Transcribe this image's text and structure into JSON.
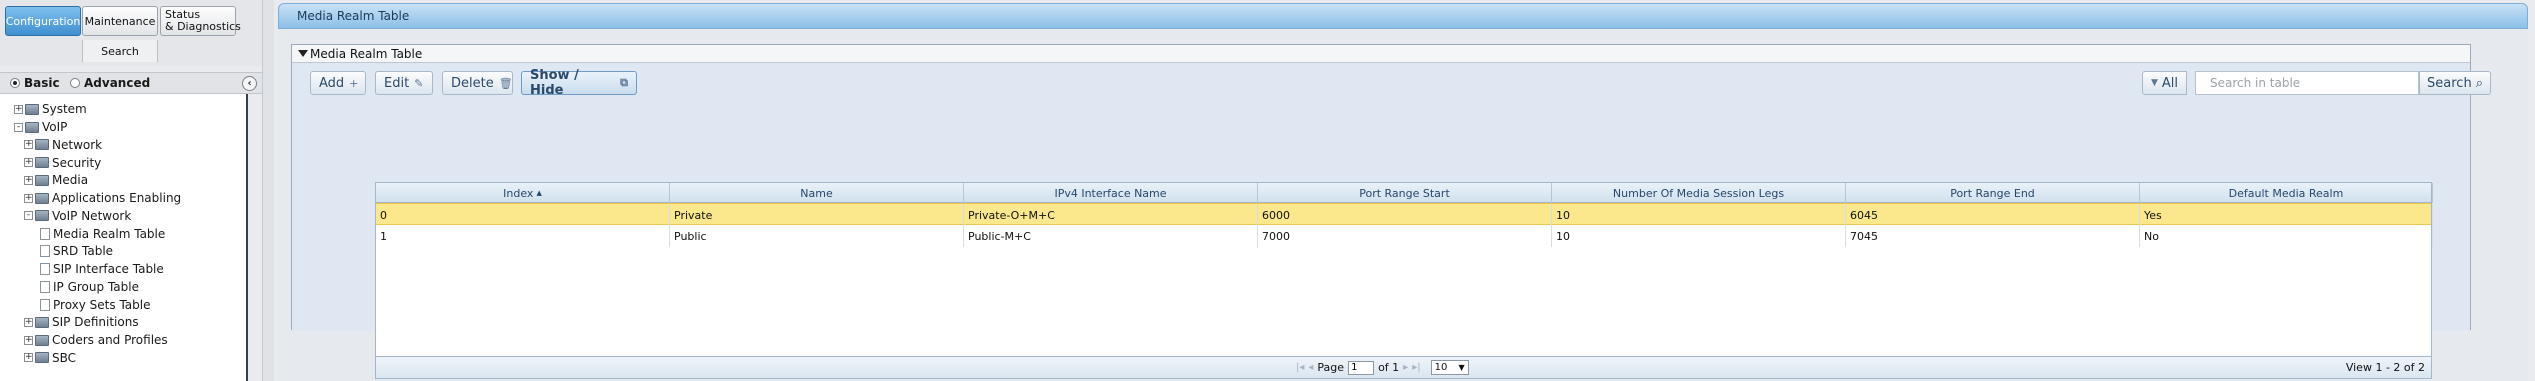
{
  "top_tabs": {
    "configuration": "Configuration",
    "maintenance": "Maintenance",
    "status": "Status\n& Diagnostics",
    "search": "Search"
  },
  "mode": {
    "basic": "Basic",
    "advanced": "Advanced",
    "selected": "Basic"
  },
  "collapse_icon": "chevron-left-icon",
  "nav_tree": {
    "items": [
      {
        "label": "System",
        "expander": "+"
      },
      {
        "label": "VoIP",
        "expander": "-"
      },
      {
        "label": "Network",
        "expander": "+"
      },
      {
        "label": "Security",
        "expander": "+"
      },
      {
        "label": "Media",
        "expander": "+"
      },
      {
        "label": "Applications Enabling",
        "expander": "+"
      },
      {
        "label": "VoIP Network",
        "expander": "-"
      },
      {
        "label": "Media Realm Table"
      },
      {
        "label": "SRD Table"
      },
      {
        "label": "SIP Interface Table"
      },
      {
        "label": "IP Group Table"
      },
      {
        "label": "Proxy Sets Table"
      },
      {
        "label": "SIP Definitions",
        "expander": "+"
      },
      {
        "label": "Coders and Profiles",
        "expander": "+"
      },
      {
        "label": "SBC",
        "expander": "+"
      }
    ]
  },
  "header": {
    "title": "Media Realm Table"
  },
  "panel": {
    "title": "Media Realm Table"
  },
  "toolbar": {
    "add_label": "Add",
    "edit_label": "Edit",
    "delete_label": "Delete",
    "showhide_label": "Show / Hide",
    "all_label": "All",
    "search_placeholder": "Search in table",
    "search_label": "Search"
  },
  "table": {
    "columns": [
      "Index",
      "Name",
      "IPv4 Interface Name",
      "Port Range Start",
      "Number Of Media Session Legs",
      "Port Range End",
      "Default Media Realm"
    ],
    "sort_indicator": "▲",
    "rows": [
      [
        "0",
        "Private",
        "Private-O+M+C",
        "6000",
        "10",
        "6045",
        "Yes"
      ],
      [
        "1",
        "Public",
        "Public-M+C",
        "7000",
        "10",
        "7045",
        "No"
      ]
    ],
    "selected_row": 0
  },
  "pager": {
    "page_label": "Page",
    "page_value": "1",
    "of_label": "of 1",
    "rows_per_page": "10",
    "view_info": "View 1 - 2 of 2"
  },
  "colors": {
    "accent": "#3f8fd0",
    "selected_row": "#fbe88c",
    "header_band": "#8cc0e8"
  }
}
